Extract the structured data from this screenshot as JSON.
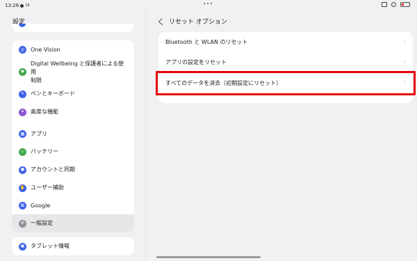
{
  "status": {
    "time": "13:26",
    "indicator": "19"
  },
  "left": {
    "title": "設定",
    "groups": [
      {
        "items": [
          {
            "label": "One Vision",
            "icon": "one-vision-icon",
            "color": "#3e64e8",
            "glyph": "◎"
          },
          {
            "label": "Digital Wellbeing と保護者による使用\n制限",
            "icon": "wellbeing-icon",
            "color": "#3fa74a",
            "glyph": "♥"
          },
          {
            "label": "ペンとキーボード",
            "icon": "pen-icon",
            "color": "#3e64e8",
            "glyph": "✎"
          },
          {
            "label": "高度な機能",
            "icon": "advanced-features-icon",
            "color": "#8e55d6",
            "glyph": "✦"
          }
        ]
      },
      {
        "items": [
          {
            "label": "アプリ",
            "icon": "apps-icon",
            "color": "#3e64e8",
            "glyph": "▦"
          },
          {
            "label": "バッテリー",
            "icon": "battery-icon",
            "color": "#3fa74a",
            "glyph": "▭"
          },
          {
            "label": "アカウントと同期",
            "icon": "account-icon",
            "color": "#3e64e8",
            "glyph": "●"
          },
          {
            "label": "ユーザー補助",
            "icon": "accessibility-icon",
            "color": "#3e64e8",
            "glyph": "✋"
          },
          {
            "label": "Google",
            "icon": "google-icon",
            "color": "#3e64e8",
            "glyph": "G"
          },
          {
            "label": "一般設定",
            "icon": "general-settings-icon",
            "color": "#8f8f95",
            "glyph": "⚙",
            "selected": true
          }
        ]
      },
      {
        "items": [
          {
            "label": "タブレット情報",
            "icon": "tablet-info-icon",
            "color": "#3e64e8",
            "glyph": "▣"
          }
        ]
      }
    ]
  },
  "right": {
    "back_glyph": "く",
    "title": "リセット オプション",
    "rows": [
      {
        "label": "Bluetooth と WLAN のリセット"
      },
      {
        "label": "アプリの設定をリセット"
      },
      {
        "label": "すべてのデータを消去（初期設定にリセット）"
      }
    ],
    "chevron": "›"
  },
  "colors": {
    "highlight": "#e6000a",
    "accent": "#3e64e8"
  }
}
